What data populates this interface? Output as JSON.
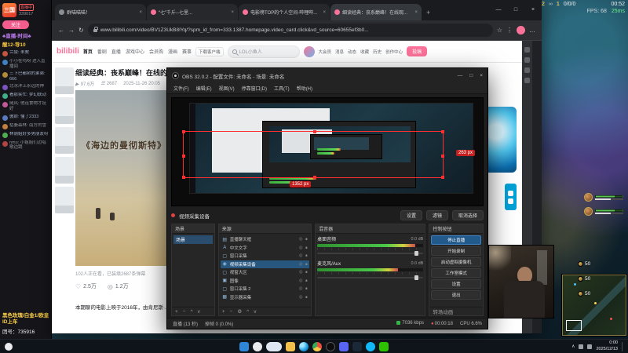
{
  "icons": {
    "back": "←",
    "forward": "→",
    "reload": "↻",
    "star": "☆",
    "ext": "⋮",
    "menu": "…",
    "min": "—",
    "max": "□",
    "close": "×",
    "newtab": "+",
    "play": "▶",
    "danmaku": "☰",
    "like": "♡",
    "coin": "◎",
    "eye": "◎",
    "lock": "∎",
    "plus": "+",
    "minus": "−",
    "up": "^",
    "down": "v",
    "gear": "⚙",
    "tray": "∧",
    "rec": "●"
  },
  "game": {
    "score_left": "2",
    "score_sep": "∞",
    "score_right": "1",
    "kda": "0/0/0",
    "clock": "00:52",
    "fps": "FPS: 68",
    "ping": "25ms",
    "timers": [
      "50",
      "50",
      "50"
    ]
  },
  "left_panel": {
    "logo": "三国",
    "badge": "直播中",
    "room_id": "339017",
    "follow": "关注",
    "line1": "♣直播-时间♣",
    "line2": "醒12-导10",
    "chat": [
      "兰陵: 未救",
      "小小在吗呀 进入直播间",
      "三下巴都树的弟弟: 666",
      "北冰洋上永远的神",
      "看那笑忙: 梦幻联动",
      "随风: 他连食物才挺好",
      "傲娇: 懂了2333",
      "枯萎森林: 南方的雪",
      "林荫姐好多男朋友呀",
      "nmu: 小姐姐们边唱歌边跳"
    ],
    "notice1": "黑色玫瑰/白金1/欧皇ID上车",
    "notice2": "团号：735916"
  },
  "browser": {
    "tabs": [
      "群喵喵喵！",
      "“七”千斤--七里...",
      "电影榜TOP的个人空间-哔哩哔...",
      "细读经典：丧系巅峰！在线观..."
    ],
    "url": "www.bilibili.com/video/BV1Z3UkB8IYq/?spm_id_from=333.1387.homepage.video_card.click&vd_source=60655ef3b0..."
  },
  "bili": {
    "logo": "bilibili",
    "nav": [
      "首页",
      "番剧",
      "直播",
      "游戏中心",
      "会员购",
      "漫画",
      "赛事"
    ],
    "download": "下载客户端",
    "search": "LOL小鱼人",
    "links": [
      "大会员",
      "消息",
      "动态",
      "收藏",
      "历史",
      "创作中心"
    ],
    "upload": "投稿"
  },
  "video": {
    "title": "细读经典：丧系巅峰！在线的",
    "views": "97.6万",
    "danmaku": "2687",
    "date": "2025-11-26 20:05",
    "overlay": "《海边的曼彻斯特》",
    "watching": "102人正在看，已装填2687条弹幕",
    "like": "2.5万",
    "coin": "1.2万",
    "desc": "本期聊的电影上映于2016年，由肯尼斯·..."
  },
  "obs": {
    "title": "OBS 32.0.2 - 配置文件: 未命名 - 场景: 未命名",
    "menu": [
      "文件(F)",
      "编辑(E)",
      "视图(V)",
      "停靠窗口(D)",
      "工具(T)",
      "帮助(H)"
    ],
    "sel_w": "1352 px",
    "sel_h": "263 px",
    "src_label": "视频采集设备",
    "btn_settings": "设置",
    "btn_filters": "滤镜",
    "btn_deselect": "取消选择",
    "scenes_title": "场景",
    "scene_item": "场景",
    "sources_title": "来源",
    "sources": [
      {
        "name": "直播聊天框",
        "glyph": "▤"
      },
      {
        "name": "中文文字",
        "glyph": "A"
      },
      {
        "name": "窗口采集",
        "glyph": "▢"
      },
      {
        "name": "视频采集设备",
        "glyph": "◉"
      },
      {
        "name": "视窗大区",
        "glyph": "▢"
      },
      {
        "name": "图像",
        "glyph": "▣"
      },
      {
        "name": "窗口采集 2",
        "glyph": "▢"
      },
      {
        "name": "显示器采集",
        "glyph": "▦"
      }
    ],
    "mixer_title": "混音器",
    "mixer": [
      {
        "name": "桌面音频",
        "db": "0.0 dB",
        "level": 0.92
      },
      {
        "name": "麦克风/Aux",
        "db": "0.0 dB",
        "level": 0.76
      }
    ],
    "controls_title": "控制按钮",
    "controls": [
      "停止直播",
      "开始录制",
      "启动虚拟摄像机",
      "工作室模式",
      "设置",
      "退出"
    ],
    "transition": "转场动画",
    "status": {
      "live": "直播 (13 秒)",
      "drop": "掉帧 0 (0.0%)",
      "kbps": "7036 kbps",
      "rec": "00:00:18",
      "cpu": "CPU 6.6%"
    }
  },
  "taskbar": {
    "time": "0:00",
    "date": "2025/12/13"
  }
}
